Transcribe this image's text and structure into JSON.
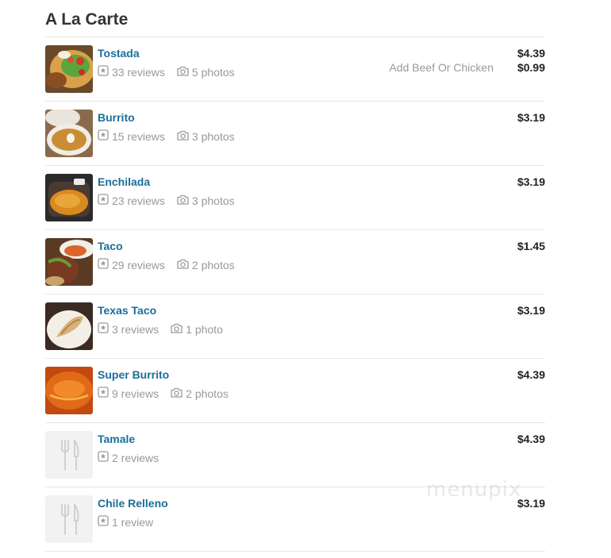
{
  "section": {
    "title": "A La Carte"
  },
  "items": [
    {
      "name": "Tostada",
      "reviews": "33 reviews",
      "photos": "5 photos",
      "option_label": "Add Beef Or Chicken",
      "price": "$4.39",
      "option_price": "$0.99",
      "thumbnail": "tostada-photo"
    },
    {
      "name": "Burrito",
      "reviews": "15 reviews",
      "photos": "3 photos",
      "price": "$3.19",
      "thumbnail": "burrito-photo"
    },
    {
      "name": "Enchilada",
      "reviews": "23 reviews",
      "photos": "3 photos",
      "price": "$3.19",
      "thumbnail": "enchilada-photo"
    },
    {
      "name": "Taco",
      "reviews": "29 reviews",
      "photos": "2 photos",
      "price": "$1.45",
      "thumbnail": "taco-photo"
    },
    {
      "name": "Texas Taco",
      "reviews": "3 reviews",
      "photos": "1 photo",
      "price": "$3.19",
      "thumbnail": "texas-taco-photo"
    },
    {
      "name": "Super Burrito",
      "reviews": "9 reviews",
      "photos": "2 photos",
      "price": "$4.39",
      "thumbnail": "super-burrito-photo"
    },
    {
      "name": "Tamale",
      "reviews": "2 reviews",
      "price": "$4.39",
      "thumbnail": "fork-knife-icon"
    },
    {
      "name": "Chile Relleno",
      "reviews": "1 review",
      "price": "$3.19",
      "thumbnail": "fork-knife-icon"
    }
  ],
  "watermark": "menupix",
  "colors": {
    "item_name": "#1a6e99",
    "meta_text": "#999999",
    "price_text": "#222222",
    "divider": "#e6e6e6"
  }
}
